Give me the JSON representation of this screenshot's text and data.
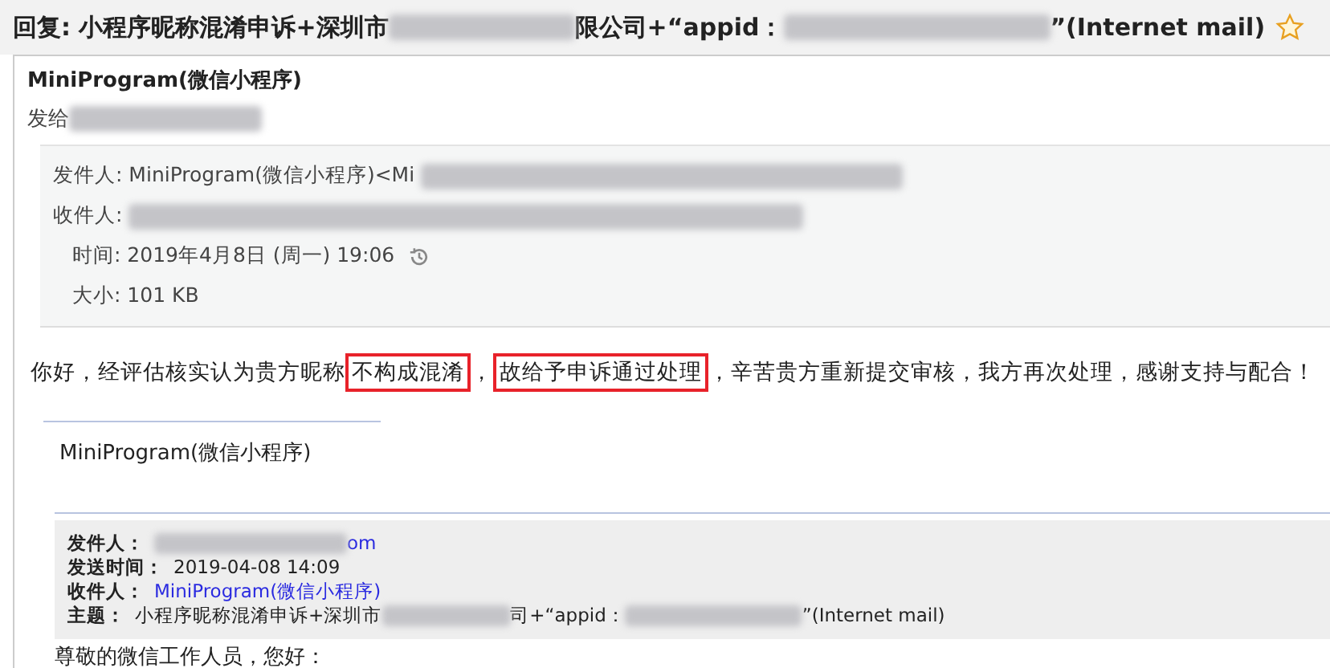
{
  "subject": {
    "segments": [
      {
        "kind": "text",
        "text": "回复: 小程序昵称混淆申诉+深圳市"
      },
      {
        "kind": "redacted"
      },
      {
        "kind": "text",
        "text": "限公司+“appid："
      },
      {
        "kind": "redacted"
      },
      {
        "kind": "text",
        "text": "”(Internet mail)"
      }
    ],
    "starred": false
  },
  "message": {
    "sender_name": "MiniProgram(微信小程序)",
    "sent_to_label": "发给",
    "details": [
      {
        "label": "发件人:",
        "value": "MiniProgram(微信小程序)<Mi",
        "redacted": true,
        "kind": "address",
        "icon": false
      },
      {
        "label": "收件人:",
        "redacted": true,
        "kind": "address",
        "icon": false
      },
      {
        "label": "时间:",
        "value": "2019年4月8日 (周一) 19:06",
        "redacted": false,
        "kind": "info",
        "icon": true
      },
      {
        "label": "大小:",
        "value": "101 KB",
        "redacted": false,
        "kind": "info",
        "icon": false
      }
    ],
    "body": [
      {
        "text": "你好，经评估核实认为贵方昵称",
        "boxed": false
      },
      {
        "text": "不构成混淆",
        "boxed": true
      },
      {
        "text": "，",
        "boxed": false
      },
      {
        "text": "故给予申诉通过处理",
        "boxed": true
      },
      {
        "text": "，辛苦贵方重新提交审核，我方再次处理，感谢支持与配合！",
        "boxed": false
      }
    ],
    "signature": "MiniProgram(微信小程序)",
    "quoted": {
      "fields": [
        {
          "label": "发件人：",
          "segments": [
            {
              "kind": "redacted"
            },
            {
              "kind": "link",
              "text": "om"
            }
          ]
        },
        {
          "label": "发送时间：",
          "segments": [
            {
              "kind": "text",
              "text": "2019-04-08 14:09"
            }
          ]
        },
        {
          "label": "收件人：",
          "segments": [
            {
              "kind": "link",
              "text": "MiniProgram(微信小程序)"
            }
          ]
        },
        {
          "label": "主题：",
          "segments": [
            {
              "kind": "text",
              "text": "小程序昵称混淆申诉+深圳市"
            },
            {
              "kind": "redacted"
            },
            {
              "kind": "text",
              "text": "司+“appid："
            },
            {
              "kind": "redacted"
            },
            {
              "kind": "text",
              "text": "”(Internet mail)"
            }
          ]
        }
      ],
      "greeting": "尊敬的微信工作人员，您好："
    }
  }
}
